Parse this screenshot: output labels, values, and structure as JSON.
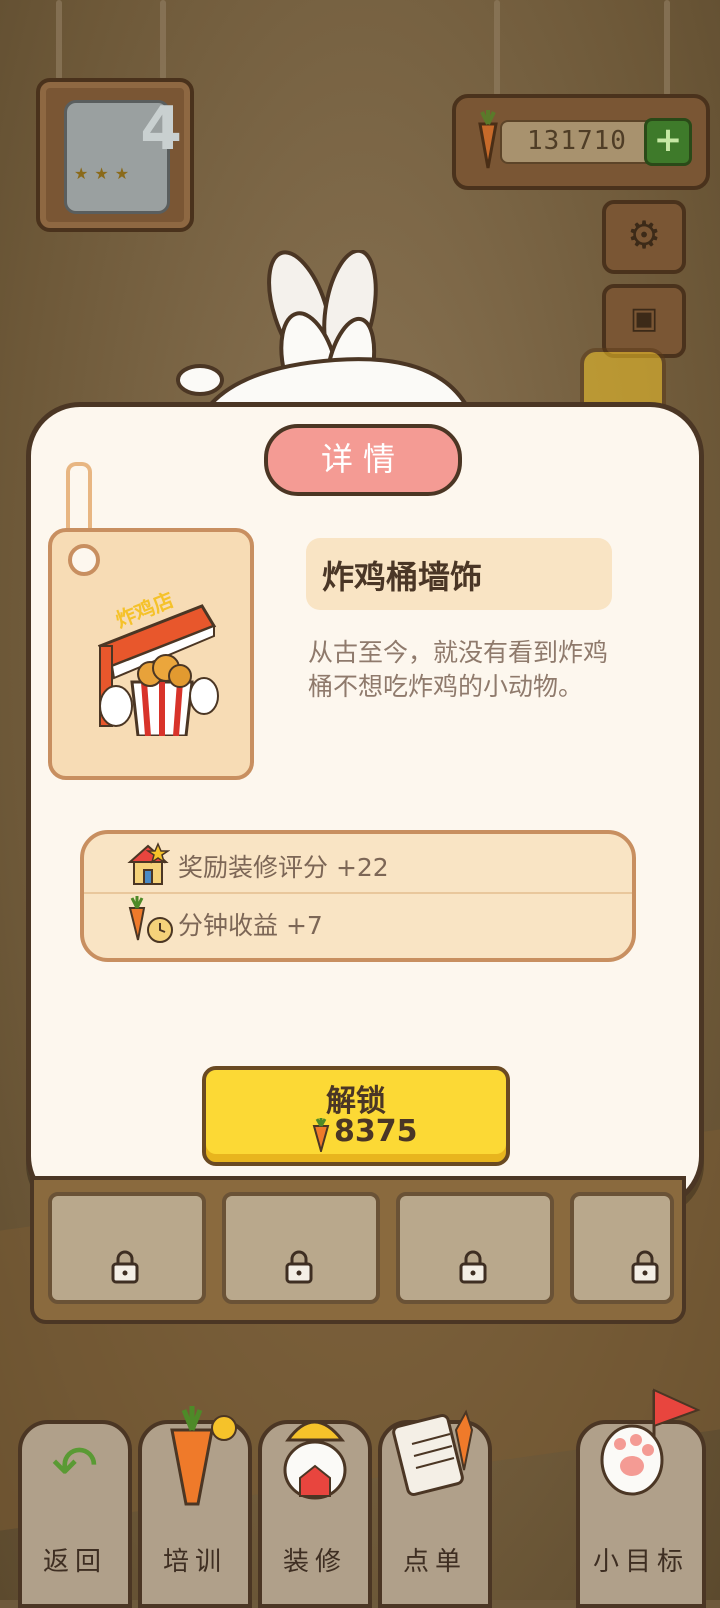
{
  "hud": {
    "level_number": "4",
    "carrot_count": "131710",
    "add_symbol": "+"
  },
  "dialog": {
    "title": "详情",
    "item_name": "炸鸡桶墙饰",
    "item_sign": "炸鸡店",
    "description": "从古至今，就没有看到炸鸡桶不想吃炸鸡的小动物。",
    "stats": [
      {
        "label": "奖励装修评分 +22",
        "icon": "house-score-icon"
      },
      {
        "label": "分钟收益 +7",
        "icon": "carrot-clock-icon"
      }
    ],
    "unlock_label": "解锁",
    "unlock_cost": "8375"
  },
  "bottom_nav": [
    {
      "label": "返回",
      "icon": "back-arrow-icon"
    },
    {
      "label": "培训",
      "icon": "carrot-trainer-icon"
    },
    {
      "label": "装修",
      "icon": "builder-icon"
    },
    {
      "label": "点单",
      "icon": "checklist-icon"
    },
    {
      "label": "小目标",
      "icon": "paw-flag-icon"
    }
  ],
  "colors": {
    "accent_yellow": "#fcd935",
    "title_pink": "#f49b94",
    "panel_cream": "#fdf7ee",
    "outline_brown": "#4b3624"
  }
}
